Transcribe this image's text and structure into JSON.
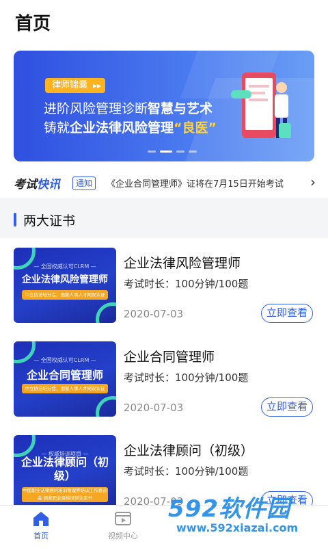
{
  "header": {
    "title": "首页"
  },
  "banner": {
    "badge": "律师锦囊",
    "line1_normal": "进阶风险管理诊断",
    "line1_bold": "智慧与艺术",
    "line2_normal": "铸就",
    "line2_bold": "企业法律风险管理",
    "line2_highlight": "“良医”",
    "active_dot": 1,
    "dot_count": 4
  },
  "news": {
    "brand_part1": "考试",
    "brand_part2": "快讯",
    "tag": "通知",
    "text": "《企业合同管理师》证将在7月15日开始考试"
  },
  "section": {
    "title": "两大证书"
  },
  "courses": [
    {
      "cover_sub": "— 全国权威认可CLRM —",
      "cover_title": "企业法律风险管理师",
      "cover_strip": "中立协法培分会、国家人事人才网双认证",
      "title": "企业法律风险管理师",
      "meta": "考试时长：100分钟/100题",
      "date": "2020-07-03",
      "button": "立即查看"
    },
    {
      "cover_sub": "— 全国权威认可CLRM —",
      "cover_title": "企业合同管理师",
      "cover_strip": "中立协法培分会、国家人事人才网双认证",
      "title": "企业合同管理师",
      "meta": "考试时长：100分钟/100题",
      "date": "2020-07-03",
      "button": "立即查看"
    },
    {
      "cover_sub": "— 权威培训项目 —",
      "cover_title": "企业法律顾问（初级）",
      "cover_strip": "中国职业法律顾问培训管理等培训工作委员会 颁发职业资格培训认定书",
      "title": "企业法律顾问（初级）",
      "meta": "考试时长：100分钟/100题",
      "date": "2020-07-03",
      "button": "立即查看"
    }
  ],
  "tabbar": {
    "tabs": [
      {
        "label": "首页",
        "icon": "home-icon"
      },
      {
        "label": "视频中心",
        "icon": "video-icon"
      }
    ]
  },
  "watermark": {
    "main": "592软件园",
    "url": "www.592xiazai.com"
  },
  "colors": {
    "accent": "#2f5fe6",
    "badge": "#ffb31f",
    "highlight": "#ffd23a"
  }
}
